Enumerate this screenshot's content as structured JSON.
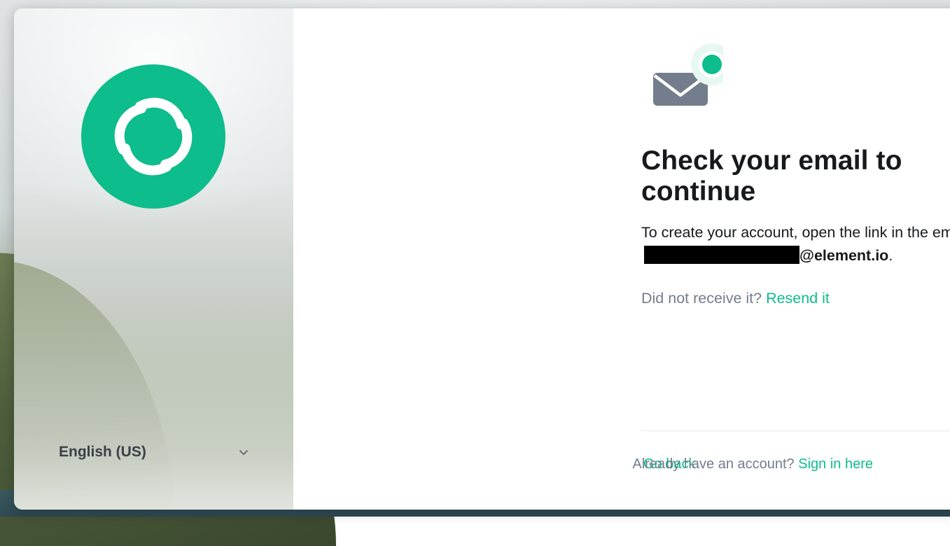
{
  "brand": {
    "accent_color": "#0dbd8b",
    "logo_icon": "element-logo-icon"
  },
  "language": {
    "selected": "English (US)",
    "chevron_icon": "chevron-down-icon"
  },
  "main": {
    "icon": "email-sent-icon",
    "title": "Check your email to continue",
    "body_prefix": "To create your account, open the link in the email we just sent to",
    "email_domain": "@element.io",
    "body_suffix": ".",
    "resend_prompt": "Did not receive it?",
    "resend_link": "Resend it"
  },
  "footer": {
    "go_back": "Go back",
    "signin_prompt": "Already have an account?",
    "signin_link": "Sign in here"
  }
}
